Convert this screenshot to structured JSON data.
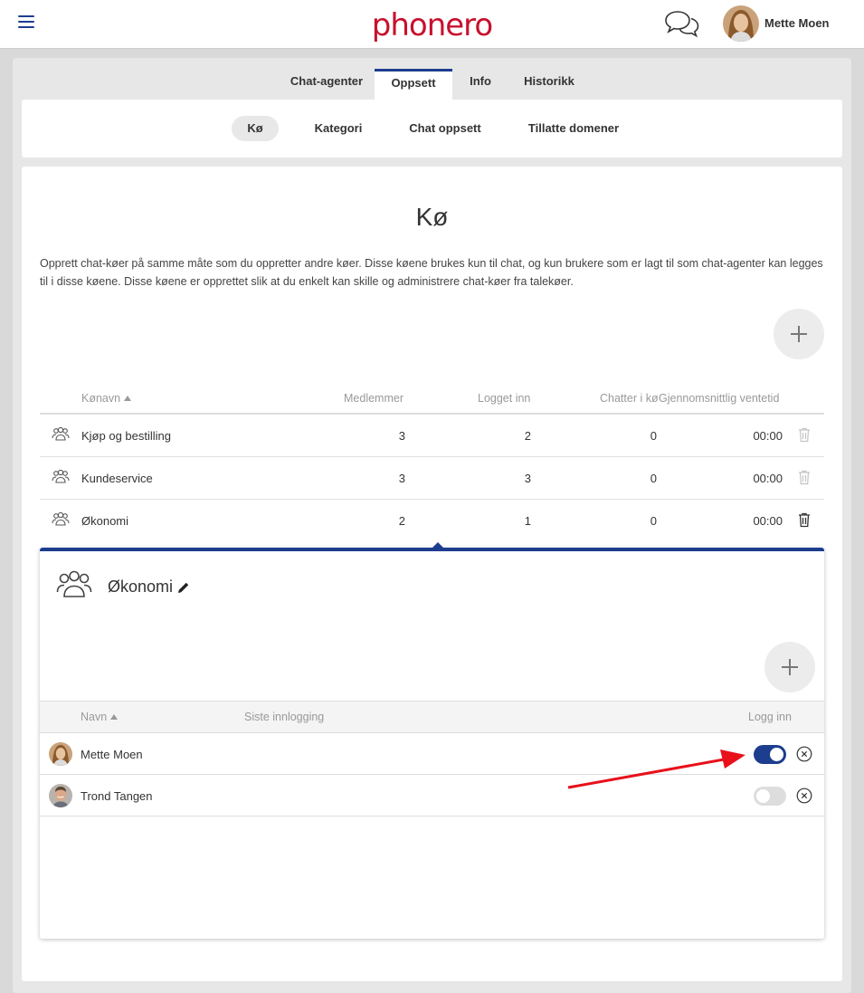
{
  "app": {
    "logo": "phonero",
    "user_name": "Mette Moen"
  },
  "tabs": [
    {
      "label": "Chat-agenter",
      "active": false
    },
    {
      "label": "Oppsett",
      "active": true
    },
    {
      "label": "Info",
      "active": false
    },
    {
      "label": "Historikk",
      "active": false
    }
  ],
  "subtabs": [
    {
      "label": "Kø",
      "active": true
    },
    {
      "label": "Kategori",
      "active": false
    },
    {
      "label": "Chat oppsett",
      "active": false
    },
    {
      "label": "Tillatte domener",
      "active": false
    }
  ],
  "page": {
    "title": "Kø",
    "description": "Opprett chat-køer på samme måte som du oppretter andre køer. Disse køene brukes kun til chat, og kun brukere som er lagt til som chat-agenter kan legges til i disse køene. Disse køene er opprettet slik at du enkelt kan skille og administrere chat-køer fra talekøer."
  },
  "queue_table": {
    "columns": [
      "Kønavn",
      "Medlemmer",
      "Logget inn",
      "Chatter i kø",
      "Gjennomsnittlig ventetid"
    ],
    "rows": [
      {
        "name": "Kjøp og bestilling",
        "members": "3",
        "logged_in": "2",
        "chats": "0",
        "wait": "00:00"
      },
      {
        "name": "Kundeservice",
        "members": "3",
        "logged_in": "3",
        "chats": "0",
        "wait": "00:00"
      },
      {
        "name": "Økonomi",
        "members": "2",
        "logged_in": "1",
        "chats": "0",
        "wait": "00:00"
      }
    ]
  },
  "detail": {
    "title": "Økonomi",
    "columns": [
      "Navn",
      "Siste innlogging",
      "Logg inn"
    ],
    "members": [
      {
        "name": "Mette Moen",
        "last_login": "",
        "logged_in": true
      },
      {
        "name": "Trond Tangen",
        "last_login": "",
        "logged_in": false
      }
    ]
  },
  "colors": {
    "brand_red": "#c8102e",
    "accent_blue": "#1d3e8f",
    "annotation_arrow": "#e8101a"
  }
}
